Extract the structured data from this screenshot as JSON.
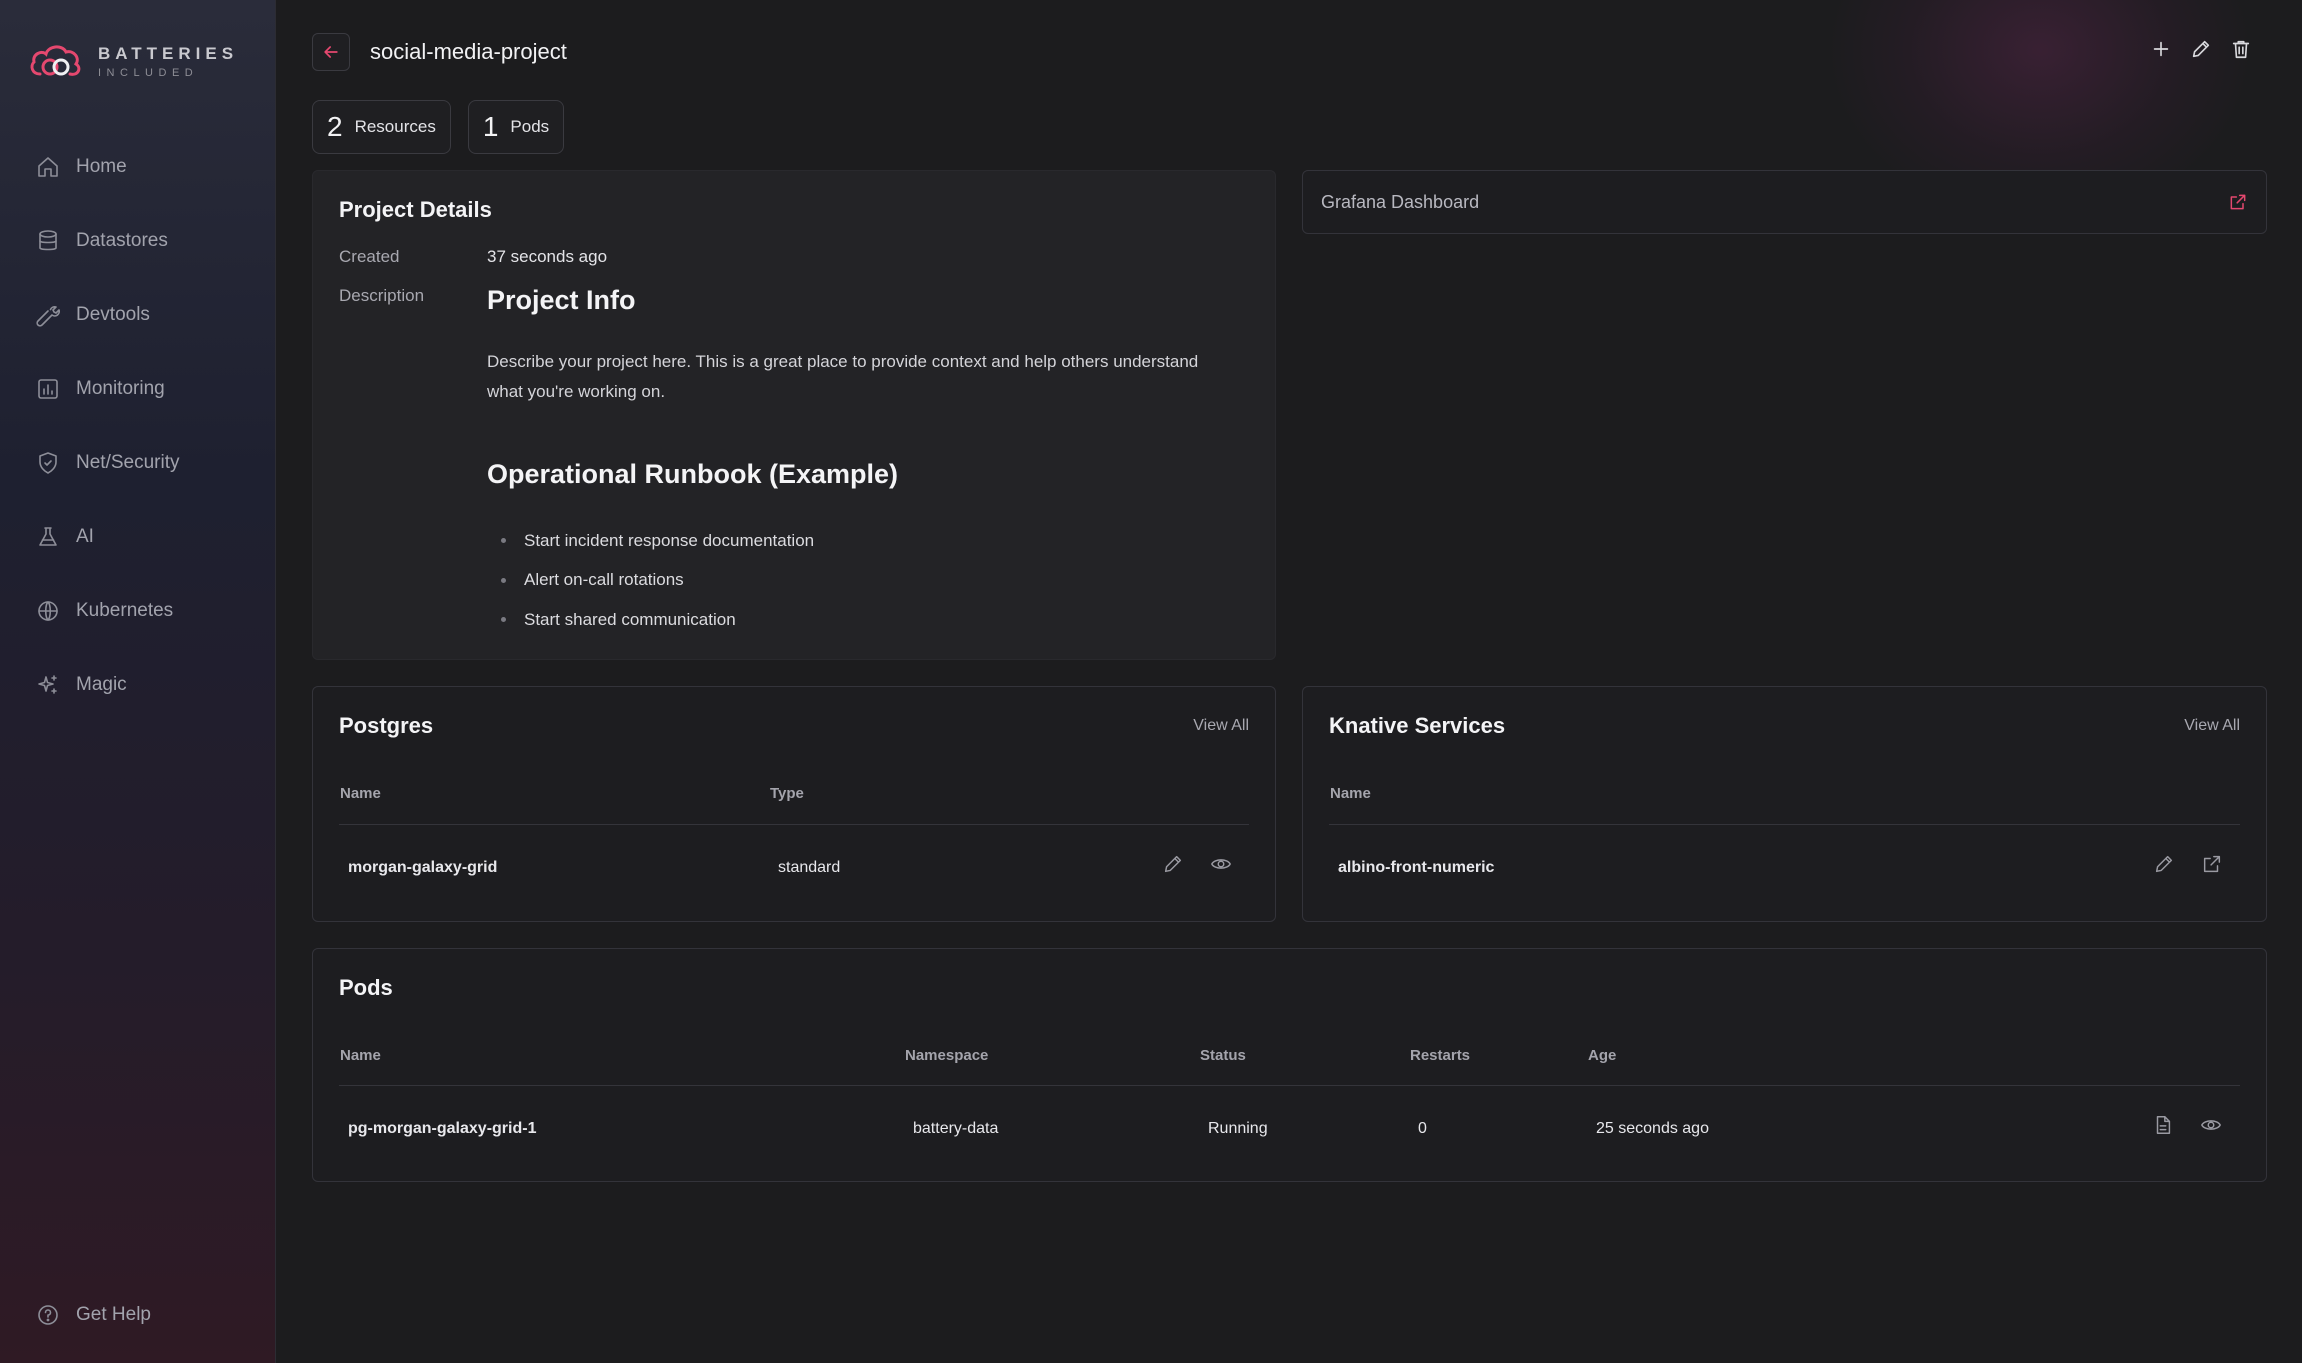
{
  "brand": {
    "line1": "BATTERIES",
    "line2": "INCLUDED"
  },
  "sidebar": {
    "items": [
      {
        "label": "Home",
        "icon": "home-icon"
      },
      {
        "label": "Datastores",
        "icon": "database-icon"
      },
      {
        "label": "Devtools",
        "icon": "wrench-icon"
      },
      {
        "label": "Monitoring",
        "icon": "chart-icon"
      },
      {
        "label": "Net/Security",
        "icon": "shield-icon"
      },
      {
        "label": "AI",
        "icon": "flask-icon"
      },
      {
        "label": "Kubernetes",
        "icon": "globe-icon"
      },
      {
        "label": "Magic",
        "icon": "sparkles-icon"
      }
    ],
    "help": "Get Help"
  },
  "header": {
    "title": "social-media-project"
  },
  "badges": [
    {
      "num": "2",
      "label": "Resources"
    },
    {
      "num": "1",
      "label": "Pods"
    }
  ],
  "details": {
    "title": "Project Details",
    "created_label": "Created",
    "created_value": "37 seconds ago",
    "description_label": "Description",
    "h1": "Project Info",
    "paragraph": "Describe your project here. This is a great place to provide context and help others understand what you're working on.",
    "h2": "Operational Runbook (Example)",
    "bullets": [
      "Start incident response documentation",
      "Alert on-call rotations",
      "Start shared communication"
    ]
  },
  "grafana": {
    "label": "Grafana Dashboard"
  },
  "postgres": {
    "title": "Postgres",
    "view_all": "View All",
    "columns": [
      "Name",
      "Type"
    ],
    "rows": [
      {
        "name": "morgan-galaxy-grid",
        "type": "standard"
      }
    ]
  },
  "knative": {
    "title": "Knative Services",
    "view_all": "View All",
    "columns": [
      "Name"
    ],
    "rows": [
      {
        "name": "albino-front-numeric"
      }
    ]
  },
  "pods": {
    "title": "Pods",
    "columns": [
      "Name",
      "Namespace",
      "Status",
      "Restarts",
      "Age"
    ],
    "rows": [
      {
        "name": "pg-morgan-galaxy-grid-1",
        "namespace": "battery-data",
        "status": "Running",
        "restarts": "0",
        "age": "25 seconds ago"
      }
    ]
  },
  "colors": {
    "accent": "#e5486f",
    "background": "#1c1c1e"
  }
}
